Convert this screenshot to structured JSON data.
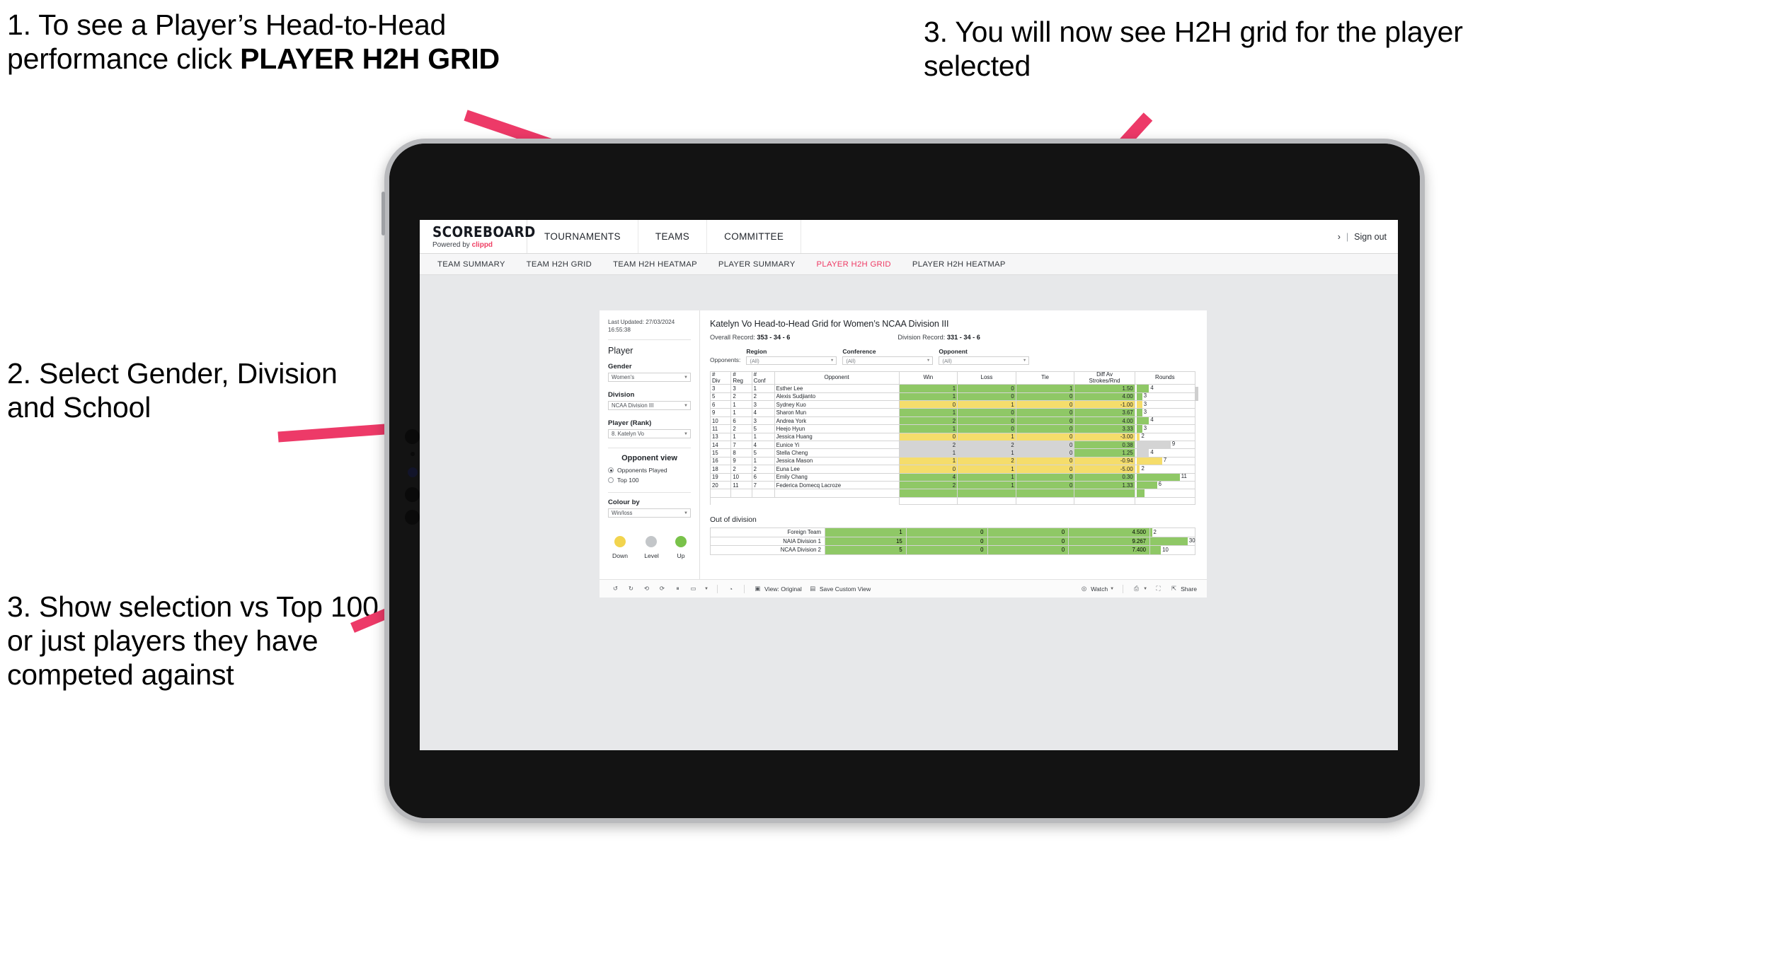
{
  "annotations": [
    {
      "id": "callout-1",
      "text_plain": "1. To see a Player’s Head-to-Head performance click ",
      "text_bold": "PLAYER H2H GRID"
    },
    {
      "id": "callout-2",
      "text": "2. Select Gender, Division and School"
    },
    {
      "id": "callout-3",
      "text": "3. Show selection vs Top 100 or just players they have competed against"
    },
    {
      "id": "callout-4",
      "text": "3. You will now see H2H grid for the player selected"
    }
  ],
  "arrow_color": "#ed3a68",
  "app": {
    "brand": {
      "name": "SCOREBOARD",
      "powered_prefix": "Powered by ",
      "powered_brand": "clippd"
    },
    "top_nav": [
      "TOURNAMENTS",
      "TEAMS",
      "COMMITTEE"
    ],
    "header_right": {
      "chevron": "›",
      "separator": "|",
      "sign_out": "Sign out"
    },
    "sub_nav": [
      {
        "label": "TEAM SUMMARY",
        "active": false
      },
      {
        "label": "TEAM H2H GRID",
        "active": false
      },
      {
        "label": "TEAM H2H HEATMAP",
        "active": false
      },
      {
        "label": "PLAYER SUMMARY",
        "active": false
      },
      {
        "label": "PLAYER H2H GRID",
        "active": true
      },
      {
        "label": "PLAYER H2H HEATMAP",
        "active": false
      }
    ],
    "accent_color": "#ee3a64"
  },
  "filter_pane": {
    "last_updated": "Last Updated: 27/03/2024 16:55:38",
    "section_player": "Player",
    "gender": {
      "label": "Gender",
      "value": "Women's"
    },
    "division": {
      "label": "Division",
      "value": "NCAA Division III"
    },
    "player_rank": {
      "label": "Player (Rank)",
      "value": "8. Katelyn Vo"
    },
    "opponent_view": {
      "title": "Opponent view",
      "options": [
        {
          "label": "Opponents Played",
          "selected": true
        },
        {
          "label": "Top 100",
          "selected": false
        }
      ]
    },
    "colour_by": {
      "label": "Colour by",
      "value": "Win/loss"
    },
    "legend": [
      {
        "label": "Down",
        "color": "#f2d44e"
      },
      {
        "label": "Level",
        "color": "#c3c6c9"
      },
      {
        "label": "Up",
        "color": "#79c24a"
      }
    ]
  },
  "viz": {
    "title": "Katelyn Vo Head-to-Head Grid for Women’s NCAA Division III",
    "overall_record_label": "Overall Record:",
    "overall_record_value": "353 - 34 - 6",
    "division_record_label": "Division Record:",
    "division_record_value": "331 - 34 - 6",
    "opponents_label": "Opponents:",
    "opponent_filters": [
      {
        "label": "Region",
        "value": "(All)"
      },
      {
        "label": "Conference",
        "value": "(All)"
      },
      {
        "label": "Opponent",
        "value": "(All)"
      }
    ],
    "table": {
      "headers": [
        "#\nDiv",
        "#\nReg",
        "#\nConf",
        "Opponent",
        "Win",
        "Loss",
        "Tie",
        "Diff Av\nStrokes/Rnd",
        "Rounds"
      ],
      "rows": [
        {
          "div": "3",
          "reg": "3",
          "conf": "1",
          "opponent": "Esther Lee",
          "win": "1",
          "loss": "0",
          "tie": "1",
          "diff": "1.50",
          "rounds": "4",
          "color": "g",
          "bar_pct": 22
        },
        {
          "div": "5",
          "reg": "2",
          "conf": "2",
          "opponent": "Alexis Sudjianto",
          "win": "1",
          "loss": "0",
          "tie": "0",
          "diff": "4.00",
          "rounds": "3",
          "color": "g",
          "bar_pct": 10
        },
        {
          "div": "6",
          "reg": "1",
          "conf": "3",
          "opponent": "Sydney Kuo",
          "win": "0",
          "loss": "1",
          "tie": "0",
          "diff": "-1.00",
          "rounds": "3",
          "color": "y",
          "bar_pct": 10
        },
        {
          "div": "9",
          "reg": "1",
          "conf": "4",
          "opponent": "Sharon Mun",
          "win": "1",
          "loss": "0",
          "tie": "0",
          "diff": "3.67",
          "rounds": "3",
          "color": "g",
          "bar_pct": 10
        },
        {
          "div": "10",
          "reg": "6",
          "conf": "3",
          "opponent": "Andrea York",
          "win": "2",
          "loss": "0",
          "tie": "0",
          "diff": "4.00",
          "rounds": "4",
          "color": "g",
          "bar_pct": 22
        },
        {
          "div": "11",
          "reg": "2",
          "conf": "5",
          "opponent": "Heejo Hyun",
          "win": "1",
          "loss": "0",
          "tie": "0",
          "diff": "3.33",
          "rounds": "3",
          "color": "g",
          "bar_pct": 10
        },
        {
          "div": "13",
          "reg": "1",
          "conf": "1",
          "opponent": "Jessica Huang",
          "win": "0",
          "loss": "1",
          "tie": "0",
          "diff": "-3.00",
          "rounds": "2",
          "color": "y",
          "bar_pct": 6
        },
        {
          "div": "14",
          "reg": "7",
          "conf": "4",
          "opponent": "Eunice Yi",
          "win": "2",
          "loss": "2",
          "tie": "0",
          "diff": "0.38",
          "rounds": "9",
          "color": "n",
          "bar_pct": 60,
          "diff_color": "g"
        },
        {
          "div": "15",
          "reg": "8",
          "conf": "5",
          "opponent": "Stella Cheng",
          "win": "1",
          "loss": "1",
          "tie": "0",
          "diff": "1.25",
          "rounds": "4",
          "color": "n",
          "bar_pct": 22,
          "diff_color": "g"
        },
        {
          "div": "16",
          "reg": "9",
          "conf": "1",
          "opponent": "Jessica Mason",
          "win": "1",
          "loss": "2",
          "tie": "0",
          "diff": "-0.94",
          "rounds": "7",
          "color": "y",
          "bar_pct": 45
        },
        {
          "div": "18",
          "reg": "2",
          "conf": "2",
          "opponent": "Euna Lee",
          "win": "0",
          "loss": "1",
          "tie": "0",
          "diff": "-5.00",
          "rounds": "2",
          "color": "y",
          "bar_pct": 6
        },
        {
          "div": "19",
          "reg": "10",
          "conf": "6",
          "opponent": "Emily Chang",
          "win": "4",
          "loss": "1",
          "tie": "0",
          "diff": "0.30",
          "rounds": "11",
          "color": "g",
          "bar_pct": 76
        },
        {
          "div": "20",
          "reg": "11",
          "conf": "7",
          "opponent": "Federica Domecq Lacroze",
          "win": "2",
          "loss": "1",
          "tie": "0",
          "diff": "1.33",
          "rounds": "6",
          "color": "g",
          "bar_pct": 36
        }
      ]
    },
    "out_of_division": {
      "title": "Out of division",
      "rows": [
        {
          "label": "Foreign Team",
          "win": "1",
          "loss": "0",
          "tie": "0",
          "diff": "4.500",
          "rounds": "2",
          "color": "g",
          "bar_pct": 4
        },
        {
          "label": "NAIA Division 1",
          "win": "15",
          "loss": "0",
          "tie": "0",
          "diff": "9.267",
          "rounds": "30",
          "color": "g",
          "bar_pct": 84
        },
        {
          "label": "NCAA Division 2",
          "win": "5",
          "loss": "0",
          "tie": "0",
          "diff": "7.400",
          "rounds": "10",
          "color": "g",
          "bar_pct": 24
        }
      ]
    },
    "toolbar": {
      "view_original": "View: Original",
      "save_custom_view": "Save Custom View",
      "watch": "Watch",
      "share": "Share"
    }
  }
}
